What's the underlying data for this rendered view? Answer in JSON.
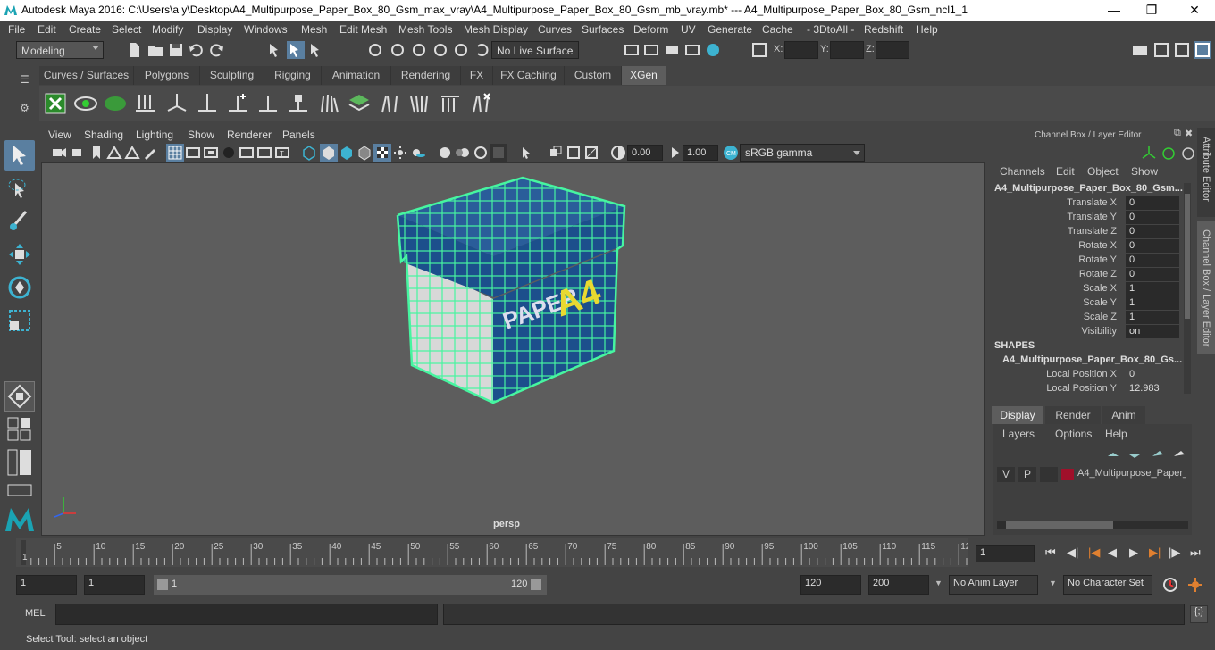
{
  "window": {
    "title": "Autodesk Maya 2016: C:\\Users\\a y\\Desktop\\A4_Multipurpose_Paper_Box_80_Gsm_max_vray\\A4_Multipurpose_Paper_Box_80_Gsm_mb_vray.mb*   ---   A4_Multipurpose_Paper_Box_80_Gsm_ncl1_1",
    "minimize": "—",
    "maximize": "❐",
    "close": "✕"
  },
  "menubar": [
    "File",
    "Edit",
    "Create",
    "Select",
    "Modify",
    "Display",
    "Windows",
    "Mesh",
    "Edit Mesh",
    "Mesh Tools",
    "Mesh Display",
    "Curves",
    "Surfaces",
    "Deform",
    "UV",
    "Generate",
    "Cache",
    "- 3DtoAll -",
    "Redshift",
    "Help"
  ],
  "statusline": {
    "mode": "Modeling",
    "live_surface": "No Live Surface",
    "x_label": "X:",
    "y_label": "Y:",
    "z_label": "Z:"
  },
  "shelf_tabs": [
    {
      "label": "Curves / Surfaces",
      "active": false
    },
    {
      "label": "Polygons",
      "active": false
    },
    {
      "label": "Sculpting",
      "active": false
    },
    {
      "label": "Rigging",
      "active": false
    },
    {
      "label": "Animation",
      "active": false
    },
    {
      "label": "Rendering",
      "active": false
    },
    {
      "label": "FX",
      "active": false
    },
    {
      "label": "FX Caching",
      "active": false
    },
    {
      "label": "Custom",
      "active": false
    },
    {
      "label": "XGen",
      "active": true
    }
  ],
  "panel_menu": [
    "View",
    "Shading",
    "Lighting",
    "Show",
    "Renderer",
    "Panels"
  ],
  "panel_toolbar": {
    "near_value": "0.00",
    "far_value": "1.00",
    "color_space": "sRGB gamma"
  },
  "viewport": {
    "camera_label": "persp",
    "box_text_brand": "PAPER",
    "box_text_size": "A4"
  },
  "channel_box": {
    "header": "Channel Box / Layer Editor",
    "menu": [
      "Channels",
      "Edit",
      "Object",
      "Show"
    ],
    "object_name": "A4_Multipurpose_Paper_Box_80_Gsm...",
    "channels": [
      {
        "label": "Translate X",
        "value": "0"
      },
      {
        "label": "Translate Y",
        "value": "0"
      },
      {
        "label": "Translate Z",
        "value": "0"
      },
      {
        "label": "Rotate X",
        "value": "0"
      },
      {
        "label": "Rotate Y",
        "value": "0"
      },
      {
        "label": "Rotate Z",
        "value": "0"
      },
      {
        "label": "Scale X",
        "value": "1"
      },
      {
        "label": "Scale Y",
        "value": "1"
      },
      {
        "label": "Scale Z",
        "value": "1"
      },
      {
        "label": "Visibility",
        "value": "on"
      }
    ],
    "shapes_header": "SHAPES",
    "shape_name": "A4_Multipurpose_Paper_Box_80_Gs...",
    "shape_channels": [
      {
        "label": "Local Position X",
        "value": "0"
      },
      {
        "label": "Local Position Y",
        "value": "12.983"
      }
    ],
    "side_tabs": [
      "Attribute Editor",
      "Channel Box / Layer Editor"
    ]
  },
  "layer_editor": {
    "tabs": [
      {
        "label": "Display",
        "active": true
      },
      {
        "label": "Render",
        "active": false
      },
      {
        "label": "Anim",
        "active": false
      }
    ],
    "menu": [
      "Layers",
      "Options",
      "Help"
    ],
    "layer": {
      "v": "V",
      "p": "P",
      "name": "A4_Multipurpose_Paper_",
      "color": "#a0102a"
    }
  },
  "timeline": {
    "ticks": [
      "5",
      "10",
      "15",
      "20",
      "25",
      "30",
      "35",
      "40",
      "45",
      "50",
      "55",
      "60",
      "65",
      "70",
      "75",
      "80",
      "85",
      "90",
      "95",
      "100",
      "105",
      "110",
      "115",
      "12"
    ],
    "start_frame_marker": "1",
    "current_frame": "1"
  },
  "range": {
    "start": "1",
    "playback_start": "1",
    "slider_start": "1",
    "slider_end": "120",
    "playback_end": "120",
    "end": "200",
    "anim_layer": "No Anim Layer",
    "character_set": "No Character Set"
  },
  "command": {
    "label": "MEL"
  },
  "helpline": {
    "text": "Select Tool: select an object"
  },
  "colors": {
    "box_blue": "#1c4f8c",
    "wire_green": "#46f5a0",
    "accent_teal": "#5ac8c8"
  }
}
